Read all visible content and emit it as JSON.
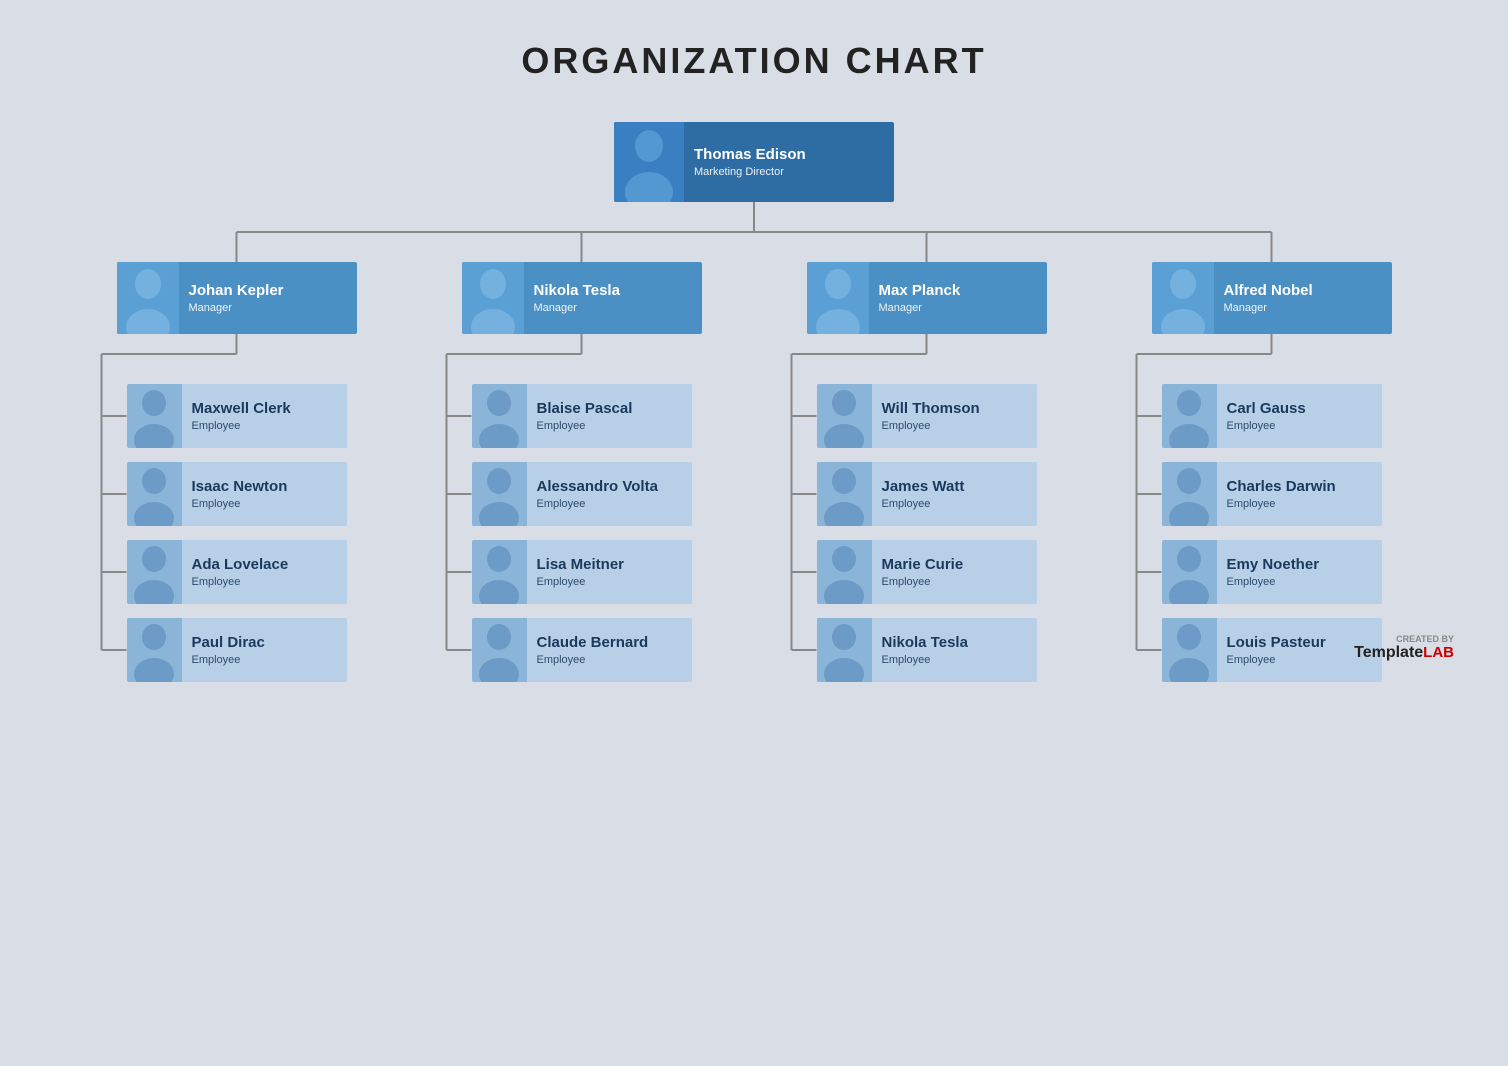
{
  "title": "ORGANIZATION CHART",
  "director": {
    "name": "Thomas Edison",
    "role": "Marketing Director"
  },
  "managers": [
    {
      "name": "Johan Kepler",
      "role": "Manager"
    },
    {
      "name": "Nikola Tesla",
      "role": "Manager"
    },
    {
      "name": "Max Planck",
      "role": "Manager"
    },
    {
      "name": "Alfred Nobel",
      "role": "Manager"
    }
  ],
  "employees": [
    [
      {
        "name": "Maxwell Clerk",
        "role": "Employee"
      },
      {
        "name": "Isaac Newton",
        "role": "Employee"
      },
      {
        "name": "Ada Lovelace",
        "role": "Employee"
      },
      {
        "name": "Paul Dirac",
        "role": "Employee"
      }
    ],
    [
      {
        "name": "Blaise Pascal",
        "role": "Employee"
      },
      {
        "name": "Alessandro Volta",
        "role": "Employee"
      },
      {
        "name": "Lisa Meitner",
        "role": "Employee"
      },
      {
        "name": "Claude Bernard",
        "role": "Employee"
      }
    ],
    [
      {
        "name": "Will Thomson",
        "role": "Employee"
      },
      {
        "name": "James Watt",
        "role": "Employee"
      },
      {
        "name": "Marie Curie",
        "role": "Employee"
      },
      {
        "name": "Nikola Tesla",
        "role": "Employee"
      }
    ],
    [
      {
        "name": "Carl Gauss",
        "role": "Employee"
      },
      {
        "name": "Charles Darwin",
        "role": "Employee"
      },
      {
        "name": "Emy Noether",
        "role": "Employee"
      },
      {
        "name": "Louis Pasteur",
        "role": "Employee"
      }
    ]
  ],
  "watermark": {
    "created_by": "CREATED BY",
    "template": "Template",
    "lab": "LAB"
  }
}
